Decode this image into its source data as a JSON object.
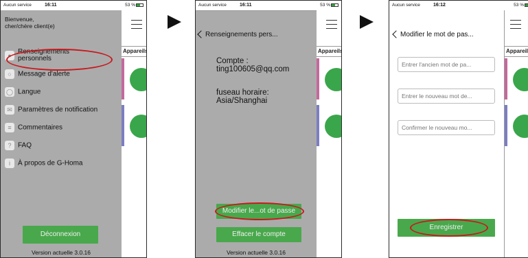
{
  "status_bar": [
    {
      "carrier": "Aucun service",
      "time": "16:11",
      "battery": "53 %"
    },
    {
      "carrier": "Aucun service",
      "time": "16:11",
      "battery": "53 %"
    },
    {
      "carrier": "Aucun service",
      "time": "16:12",
      "battery": "53 %"
    }
  ],
  "background_app": {
    "header": "Appareils"
  },
  "screen1": {
    "welcome": "Bienvenue,\ncher/chère client(e)",
    "menu": [
      {
        "label": "Renseignements personnels",
        "icon": "person-icon",
        "highlighted": true
      },
      {
        "label": "Message d'alerte",
        "icon": "chat-bubble-icon"
      },
      {
        "label": "Langue",
        "icon": "globe-icon"
      },
      {
        "label": "Paramètres de notification",
        "icon": "envelope-icon"
      },
      {
        "label": "Commentaires",
        "icon": "comment-icon"
      },
      {
        "label": "FAQ",
        "icon": "question-icon"
      },
      {
        "label": "À propos de G-Homa",
        "icon": "info-icon"
      }
    ],
    "logout_button": "Déconnexion",
    "version": "Version actuelle 3.0.16"
  },
  "screen2": {
    "nav_title": "Renseignements pers...",
    "account_label": "Compte :",
    "account_value": "ting100605@qq.com",
    "timezone_label": "fuseau horaire:",
    "timezone_value": "Asia/Shanghai",
    "change_password_button": "Modifier le...ot de passe",
    "delete_account_button": "Effacer le compte",
    "version": "Version actuelle 3.0.16"
  },
  "screen3": {
    "nav_title": "Modifier le mot de pas...",
    "old_password_placeholder": "Entrer l'ancien mot de pa...",
    "new_password_placeholder": "Entrer le nouveau mot de...",
    "confirm_password_placeholder": "Confirmer le nouveau mo...",
    "save_button": "Enregistrer"
  },
  "colors": {
    "accent_green": "#49a84c",
    "highlight_red": "#c8191e",
    "panel_grey": "#ababab"
  }
}
